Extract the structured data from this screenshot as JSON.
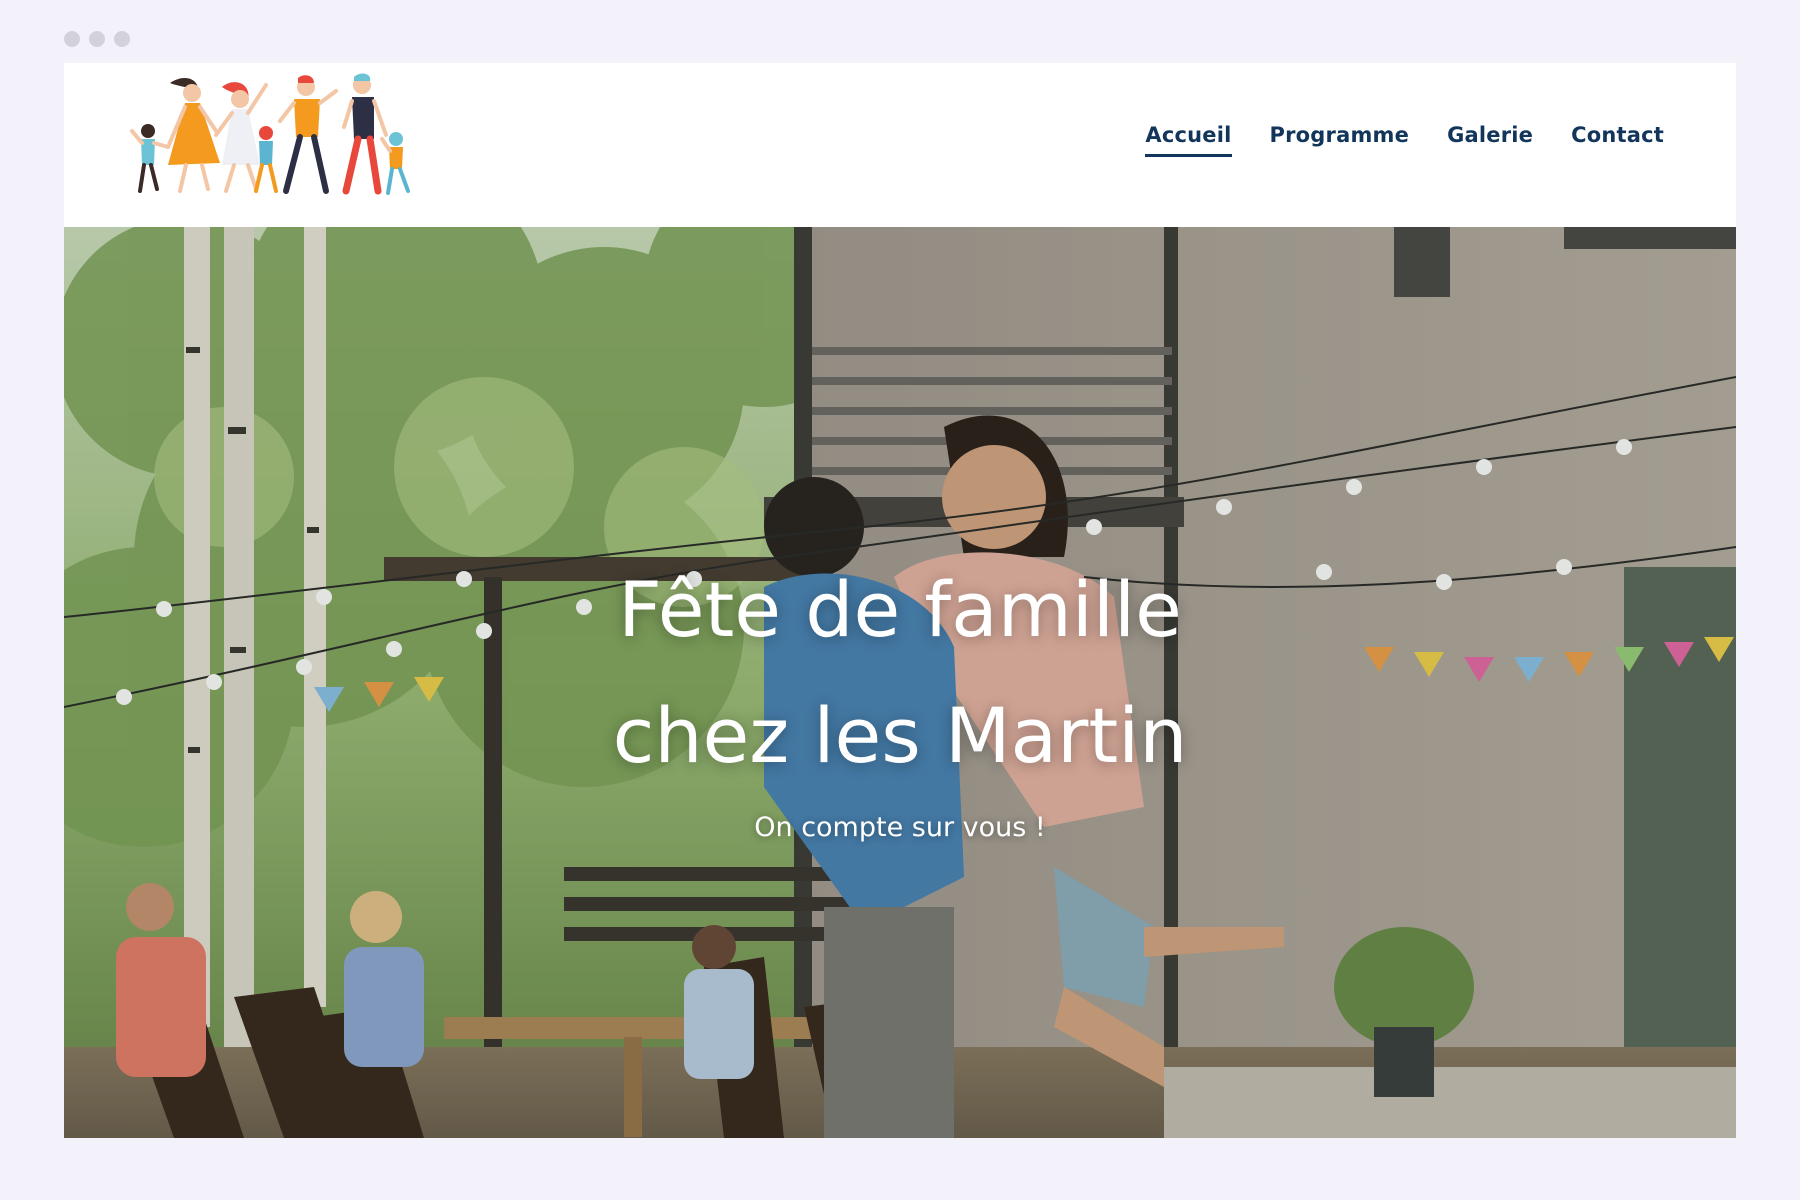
{
  "nav": {
    "items": [
      {
        "label": "Accueil",
        "active": true
      },
      {
        "label": "Programme",
        "active": false
      },
      {
        "label": "Galerie",
        "active": false
      },
      {
        "label": "Contact",
        "active": false
      }
    ]
  },
  "hero": {
    "title_line1": "Fête de famille",
    "title_line2": "chez les Martin",
    "subtitle": "On compte sur vous !"
  },
  "colors": {
    "nav_text": "#12355b",
    "page_background": "#f3f2fb",
    "hero_text": "#ffffff"
  },
  "icons": {
    "logo": "family-dancing-logo"
  }
}
